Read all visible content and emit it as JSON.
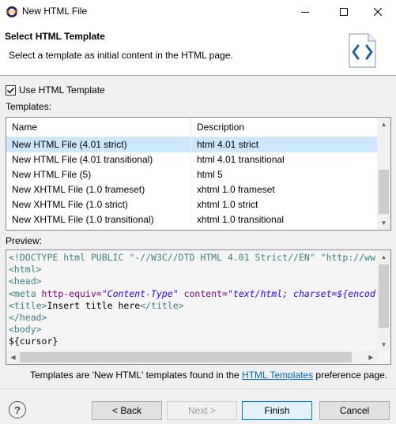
{
  "window": {
    "title": "New HTML File"
  },
  "banner": {
    "title": "Select HTML Template",
    "description": "Select a template as initial content in the HTML page."
  },
  "use_template": {
    "label": "Use HTML Template",
    "checked": true
  },
  "templates": {
    "label": "Templates:",
    "columns": [
      "Name",
      "Description"
    ],
    "rows": [
      {
        "name": "New HTML File (4.01 strict)",
        "description": "html 4.01 strict",
        "selected": true
      },
      {
        "name": "New HTML File (4.01 transitional)",
        "description": "html 4.01 transitional"
      },
      {
        "name": "New HTML File (5)",
        "description": "html 5"
      },
      {
        "name": "New XHTML File (1.0 frameset)",
        "description": "xhtml 1.0 frameset"
      },
      {
        "name": "New XHTML File (1.0 strict)",
        "description": "xhtml 1.0 strict"
      },
      {
        "name": "New XHTML File (1.0 transitional)",
        "description": "xhtml 1.0 transitional"
      }
    ]
  },
  "preview": {
    "label": "Preview:",
    "doctype": "<!DOCTYPE html PUBLIC \"-//W3C//DTD HTML 4.01 Strict//EN\" \"http://ww",
    "html_open": "<html>",
    "head_open": "<head>",
    "meta_tag_open": "<meta ",
    "meta_attr1": "http-equiv=",
    "meta_val1": "\"Content-Type\"",
    "meta_attr2": " content=",
    "meta_val2": "\"text/html; charset=${encod",
    "title_open": "<title>",
    "title_text": "Insert title here",
    "title_close": "</title>",
    "head_close": "</head>",
    "body_open": "<body>",
    "cursor": "${cursor}"
  },
  "info": {
    "prefix": "Templates are 'New HTML' templates found in the ",
    "link": "HTML Templates",
    "suffix": " preference page."
  },
  "buttons": {
    "help": "?",
    "back": "< Back",
    "next": "Next >",
    "finish": "Finish",
    "cancel": "Cancel"
  }
}
